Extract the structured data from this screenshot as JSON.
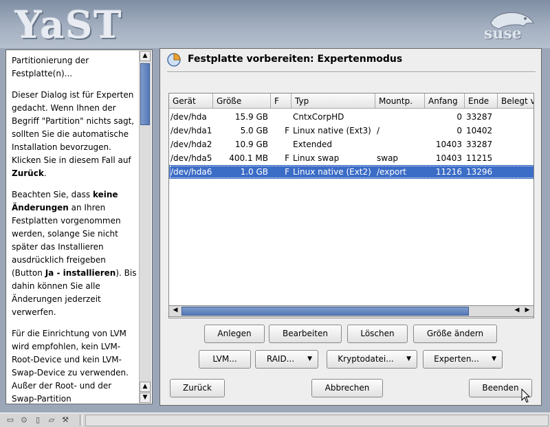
{
  "branding": {
    "product_logo": "YaST",
    "vendor_logo": "suse"
  },
  "help": {
    "paragraphs": [
      [
        {
          "t": "Partitionierung der Festplatte(n)..."
        }
      ],
      [
        {
          "t": "Dieser Dialog ist für Experten gedacht. Wenn Ihnen der Begriff \"Partition\" nichts sagt, sollten Sie die automatische Installation bevorzugen. Klicken Sie in diesem Fall auf "
        },
        {
          "t": "Zurück",
          "b": true
        },
        {
          "t": "."
        }
      ],
      [
        {
          "t": "Beachten Sie, dass "
        },
        {
          "t": "keine Änderungen",
          "b": true
        },
        {
          "t": " an Ihren Festplatten vorgenommen werden, solange Sie nicht später das Installieren ausdrücklich freigeben (Button "
        },
        {
          "t": "Ja - installieren",
          "b": true
        },
        {
          "t": "). Bis dahin können Sie alle Änderungen jederzeit verwerfen."
        }
      ],
      [
        {
          "t": "Für die Einrichtung von LVM wird empfohlen, kein LVM-Root-Device und kein LVM-Swap-Device zu verwenden. Außer der Root- und der Swap-Partition"
        }
      ]
    ]
  },
  "main": {
    "title": "Festplatte vorbereiten: Expertenmodus",
    "columns": [
      "Gerät",
      "Größe",
      "F",
      "Typ",
      "Mountp.",
      "Anfang",
      "Ende",
      "Belegt v"
    ],
    "rows": [
      {
        "device": "/dev/hda",
        "size": "15.9 GB",
        "f": "",
        "type": "CntxCorpHD",
        "mount": "",
        "start": "0",
        "end": "33287",
        "selected": false
      },
      {
        "device": "/dev/hda1",
        "size": "5.0 GB",
        "f": "F",
        "type": "Linux native (Ext3)",
        "mount": "/",
        "start": "0",
        "end": "10402",
        "selected": false
      },
      {
        "device": "/dev/hda2",
        "size": "10.9 GB",
        "f": "",
        "type": "Extended",
        "mount": "",
        "start": "10403",
        "end": "33287",
        "selected": false
      },
      {
        "device": "/dev/hda5",
        "size": "400.1 MB",
        "f": "F",
        "type": "Linux swap",
        "mount": "swap",
        "start": "10403",
        "end": "11215",
        "selected": false
      },
      {
        "device": "/dev/hda6",
        "size": "1.0 GB",
        "f": "F",
        "type": "Linux native (Ext2)",
        "mount": "/export",
        "start": "11216",
        "end": "13296",
        "selected": true
      }
    ],
    "buttons": {
      "anlegen": "Anlegen",
      "bearbeiten": "Bearbeiten",
      "loeschen": "Löschen",
      "groesse": "Größe ändern",
      "lvm": "LVM...",
      "raid": "RAID...",
      "krypto": "Kryptodatei...",
      "experten": "Experten...",
      "zurueck": "Zurück",
      "abbrechen": "Abbrechen",
      "beenden": "Beenden"
    }
  }
}
